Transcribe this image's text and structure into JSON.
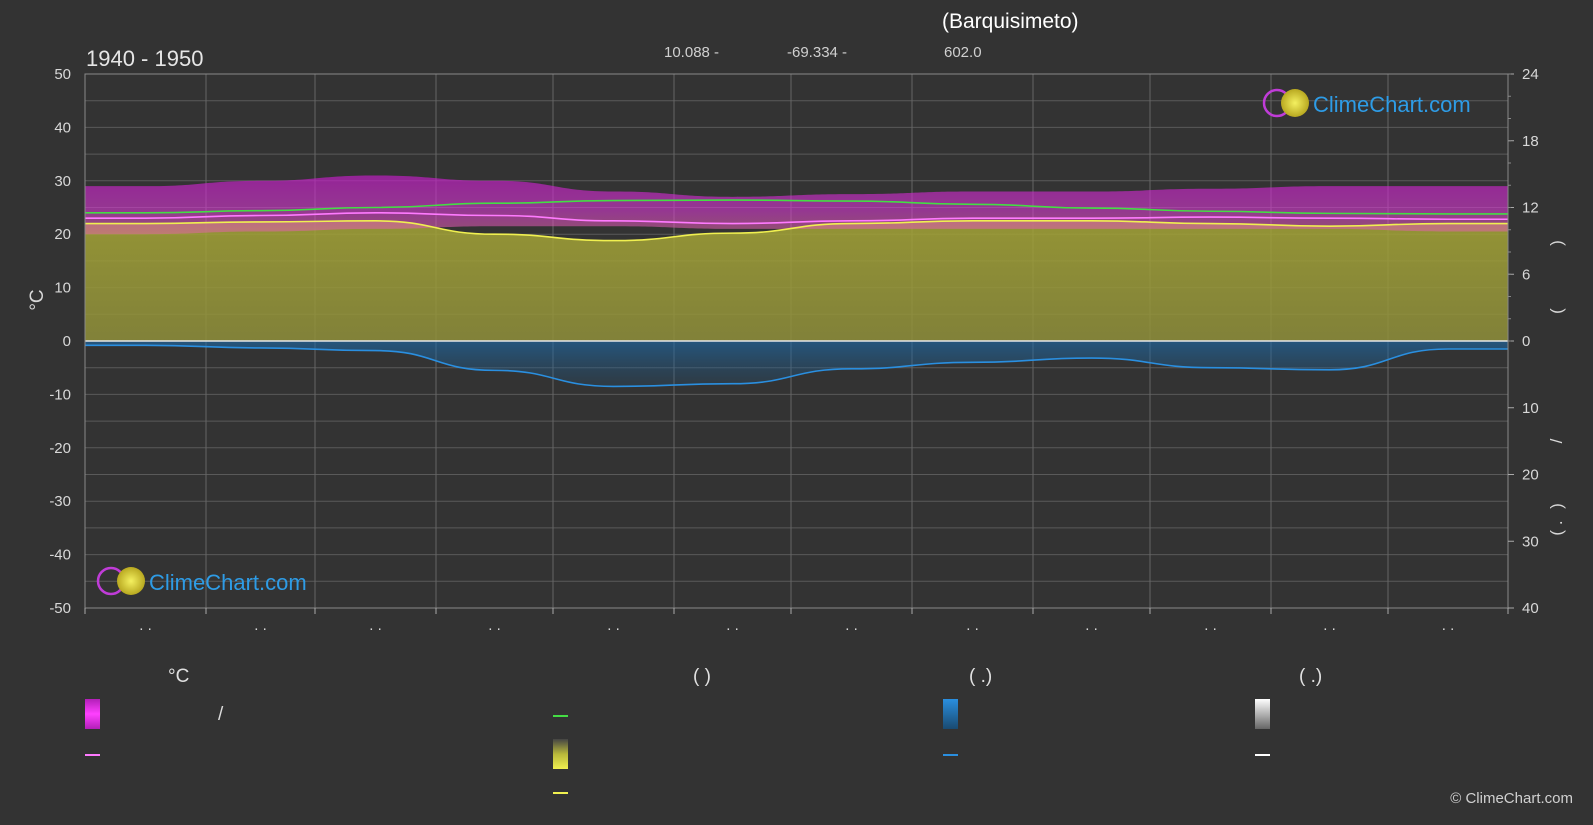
{
  "header": {
    "title": "(Barquisimeto)",
    "period": "1940 - 1950",
    "latitude": "10.088 -",
    "longitude": "-69.334 -",
    "elevation": "602.0"
  },
  "brand": {
    "logo_text": "ClimeChart.com",
    "copyright": "© ClimeChart.com"
  },
  "legend": {
    "col1_header": "°C",
    "col1_row1_text": "/",
    "col2_header": "(          )",
    "col3_header": "(   .)",
    "col4_header": "(   .)"
  },
  "colors": {
    "background": "#333333",
    "temp_band": "#d21ed2",
    "temp_mean_line": "#ff7aff",
    "daylight_line": "#44dd44",
    "sunshine_band": "#b8b83a",
    "sunshine_line": "#f0f050",
    "precip_band": "#1f6fb0",
    "precip_line": "#2a8fe0",
    "snow_line": "#ffffff"
  },
  "chart_data": {
    "type": "area",
    "title": "(Barquisimeto)",
    "subtitle": "1940 - 1950",
    "x_tick_labels": [
      ". .",
      ". .",
      ". .",
      ". .",
      ". .",
      ". .",
      ". .",
      ". .",
      ". .",
      ". .",
      ". .",
      ". ."
    ],
    "y_left": {
      "label": "°C",
      "ticks": [
        50,
        40,
        30,
        20,
        10,
        0,
        -10,
        -20,
        -30,
        -40,
        -50
      ],
      "ylim": [
        -50,
        50
      ]
    },
    "y_right_top": {
      "ticks": [
        24,
        18,
        12,
        6,
        0
      ],
      "range": [
        0,
        24
      ]
    },
    "y_right_bottom": {
      "ticks": [
        0,
        10,
        20,
        30,
        40
      ],
      "range": [
        0,
        40
      ]
    },
    "y_right_labels": [
      ")",
      "(",
      "/",
      ")",
      "( ."
    ],
    "months": 12,
    "series": [
      {
        "key": "daylight",
        "values": [
          24.0,
          24.4,
          25.0,
          25.8,
          26.3,
          26.4,
          26.2,
          25.6,
          24.9,
          24.3,
          23.9,
          23.8
        ]
      },
      {
        "key": "temp_max",
        "values": [
          29.0,
          30.0,
          31.0,
          30.0,
          28.0,
          27.0,
          27.5,
          28.0,
          28.0,
          28.5,
          29.0,
          29.0
        ]
      },
      {
        "key": "temp_min",
        "values": [
          20.0,
          20.5,
          21.0,
          21.5,
          21.5,
          21.0,
          21.0,
          21.0,
          21.0,
          21.0,
          21.0,
          20.5
        ]
      },
      {
        "key": "temp_mean",
        "values": [
          23.0,
          23.5,
          24.0,
          23.5,
          22.5,
          22.0,
          22.5,
          23.0,
          23.0,
          23.2,
          23.0,
          22.8
        ]
      },
      {
        "key": "sunshine",
        "values": [
          22.0,
          22.3,
          22.5,
          20.0,
          18.8,
          20.2,
          22.0,
          22.5,
          22.5,
          22.0,
          21.5,
          22.0
        ]
      },
      {
        "key": "precipitation",
        "values": [
          -0.8,
          -1.3,
          -1.8,
          -5.5,
          -8.5,
          -8.0,
          -5.2,
          -4.0,
          -3.2,
          -5.0,
          -5.4,
          -1.5
        ]
      }
    ]
  }
}
